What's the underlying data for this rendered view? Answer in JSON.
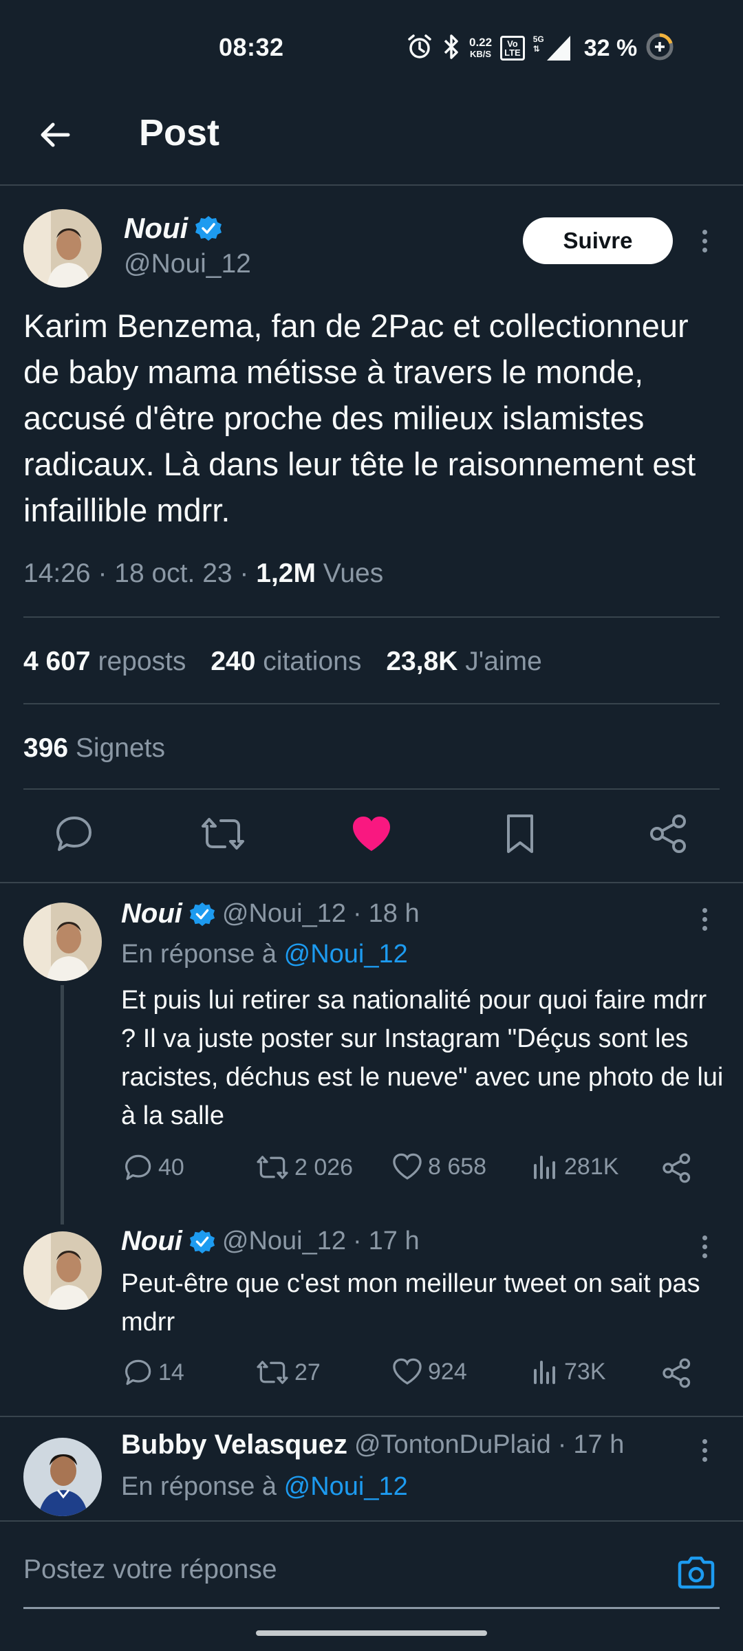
{
  "status_bar": {
    "time": "08:32",
    "net_speed_value": "0.22",
    "net_speed_unit": "KB/S",
    "volte_top": "Vo",
    "volte_bottom": "LTE",
    "network": "5G",
    "battery": "32 %"
  },
  "header": {
    "title": "Post"
  },
  "tweet": {
    "name": "Noui",
    "handle": "@Noui_12",
    "follow_label": "Suivre",
    "text": "Karim Benzema, fan de 2Pac et collectionneur de baby mama métisse à travers le monde, accusé d'être proche des milieux islamistes radicaux. Là dans leur tête le raisonnement est infaillible mdrr.",
    "time": "14:26",
    "date": "18 oct. 23",
    "views_count": "1,2M",
    "views_label": "Vues",
    "stats": {
      "reposts_count": "4 607",
      "reposts_label": "reposts",
      "quotes_count": "240",
      "quotes_label": "citations",
      "likes_count": "23,8K",
      "likes_label": "J'aime",
      "bookmarks_count": "396",
      "bookmarks_label": "Signets"
    },
    "liked": true,
    "colors": {
      "like": "#f91880",
      "verified": "#1d9bf0"
    }
  },
  "replies": [
    {
      "name": "Noui",
      "handle": "@Noui_12",
      "age": "18 h",
      "reply_to_prefix": "En réponse à",
      "reply_to_handle": "@Noui_12",
      "text": "Et puis lui retirer sa nationalité pour quoi faire mdrr ? Il va juste poster sur Instagram \"Déçus sont les racistes, déchus est le nueve\" avec une photo de lui à la salle",
      "replies": "40",
      "reposts": "2 026",
      "likes": "8 658",
      "views": "281K"
    },
    {
      "name": "Noui",
      "handle": "@Noui_12",
      "age": "17 h",
      "text": "Peut-être que c'est mon meilleur tweet on sait pas mdrr",
      "replies": "14",
      "reposts": "27",
      "likes": "924",
      "views": "73K"
    },
    {
      "name": "Bubby Velasquez",
      "handle": "@TontonDuPlaid",
      "age": "17 h",
      "reply_to_prefix": "En réponse à",
      "reply_to_handle": "@Noui_12"
    }
  ],
  "compose": {
    "placeholder": "Postez votre réponse"
  }
}
